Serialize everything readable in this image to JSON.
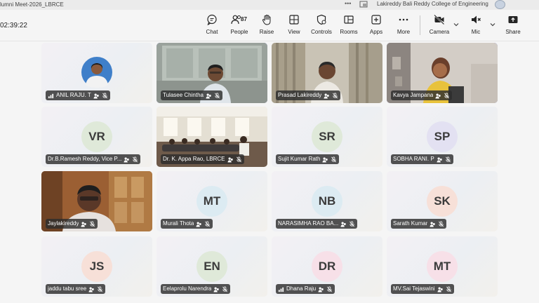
{
  "titlebar": {
    "meeting_title": "lumni Meet-2026_LBRCE",
    "college": "Lakireddy Bali Reddy College of Engineering"
  },
  "toolbar": {
    "timer": "02:39:22",
    "chat": "Chat",
    "people": "People",
    "people_count": "87",
    "raise": "Raise",
    "view": "View",
    "controls": "Controls",
    "rooms": "Rooms",
    "apps": "Apps",
    "more": "More",
    "camera": "Camera",
    "mic": "Mic",
    "share": "Share"
  },
  "participants": [
    {
      "name": "ANIL RAJU. T",
      "initials": "",
      "signal": true
    },
    {
      "name": "Tulasee Chintha",
      "initials": "",
      "signal": false
    },
    {
      "name": "Prasad Lakireddy",
      "initials": "",
      "signal": false
    },
    {
      "name": "Kavya Jampana",
      "initials": "",
      "signal": false
    },
    {
      "name": "Dr.B.Ramesh Reddy, Vice P...",
      "initials": "VR",
      "signal": false,
      "avatar_color": "#dfe9d9"
    },
    {
      "name": "Dr. K. Appa Rao, LBRCE",
      "initials": "",
      "signal": false
    },
    {
      "name": "Sujit Kumar Rath",
      "initials": "SR",
      "signal": false,
      "avatar_color": "#dfe9d9"
    },
    {
      "name": "SOBHA RANI. P",
      "initials": "SP",
      "signal": false,
      "avatar_color": "#e3e1f2"
    },
    {
      "name": "Jaylakireddy",
      "initials": "",
      "signal": false
    },
    {
      "name": "Murali Thota",
      "initials": "MT",
      "signal": false,
      "avatar_color": "#dcebf2"
    },
    {
      "name": "NARASIMHA RAO BA...",
      "initials": "NB",
      "signal": false,
      "avatar_color": "#dcebf2"
    },
    {
      "name": "Sarath Kumar",
      "initials": "SK",
      "signal": false,
      "avatar_color": "#f7e0d8"
    },
    {
      "name": "jaddu tabu sree",
      "initials": "JS",
      "signal": false,
      "avatar_color": "#f7e0d8"
    },
    {
      "name": "Eelaprolu Narendra",
      "initials": "EN",
      "signal": false,
      "avatar_color": "#dfe9d9"
    },
    {
      "name": "Dhana Raju",
      "initials": "DR",
      "signal": true,
      "avatar_color": "#f7e0e8"
    },
    {
      "name": "MV.Sai Tejaswini",
      "initials": "MT",
      "signal": false,
      "avatar_color": "#f7e0e8"
    }
  ],
  "colors": {
    "accent": "#5b5fc7",
    "namebar": "#2d2d2d",
    "muted_red": "#c4314b"
  }
}
